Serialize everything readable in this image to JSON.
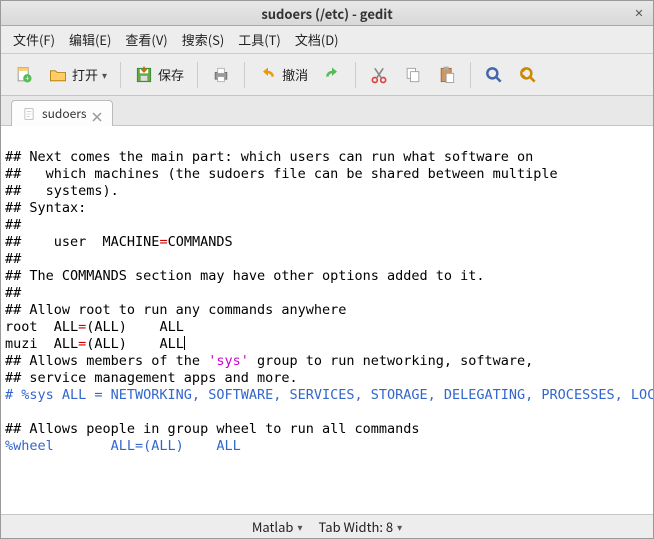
{
  "window": {
    "title": "sudoers (/etc) - gedit"
  },
  "menus": {
    "file": "文件(F)",
    "edit": "编辑(E)",
    "view": "查看(V)",
    "search": "搜索(S)",
    "tools": "工具(T)",
    "documents": "文档(D)"
  },
  "toolbar": {
    "open": "打开",
    "save": "保存",
    "undo": "撤消"
  },
  "tab": {
    "name": "sudoers"
  },
  "status": {
    "lang": "Matlab",
    "tabwidth": "Tab Width: 8"
  },
  "code": {
    "l1a": "## Next comes the main part: which users can run what software on",
    "l2a": "##   which machines (the sudoers file can be shared between multiple",
    "l3a": "##   systems).",
    "l4a": "## Syntax:",
    "l5a": "##",
    "l6a": "##    user  MACHINE",
    "l6b": "=",
    "l6c": "COMMANDS",
    "l7a": "##",
    "l8a": "## The COMMANDS section may have other options added to it.",
    "l9a": "##",
    "l10a": "## Allow root to run any commands anywhere",
    "l11a": "root  ALL",
    "l11b": "=",
    "l11c": "(ALL)    ALL",
    "l12a": "muzi  ALL",
    "l12b": "=",
    "l12c": "(ALL)    ALL",
    "l13a": "## Allows members of the ",
    "l13b": "'sys'",
    "l13c": " group to run networking, software,",
    "l14a": "## service management apps and more.",
    "l15a": "# %sys ALL = NETWORKING, SOFTWARE, SERVICES, STORAGE, DELEGATING, PROCESSES, LOCATE, DRIVERS",
    "l16a": "",
    "l17a": "## Allows people in group wheel to run all commands",
    "l18a": "%wheel       ALL=(ALL)    ALL"
  }
}
